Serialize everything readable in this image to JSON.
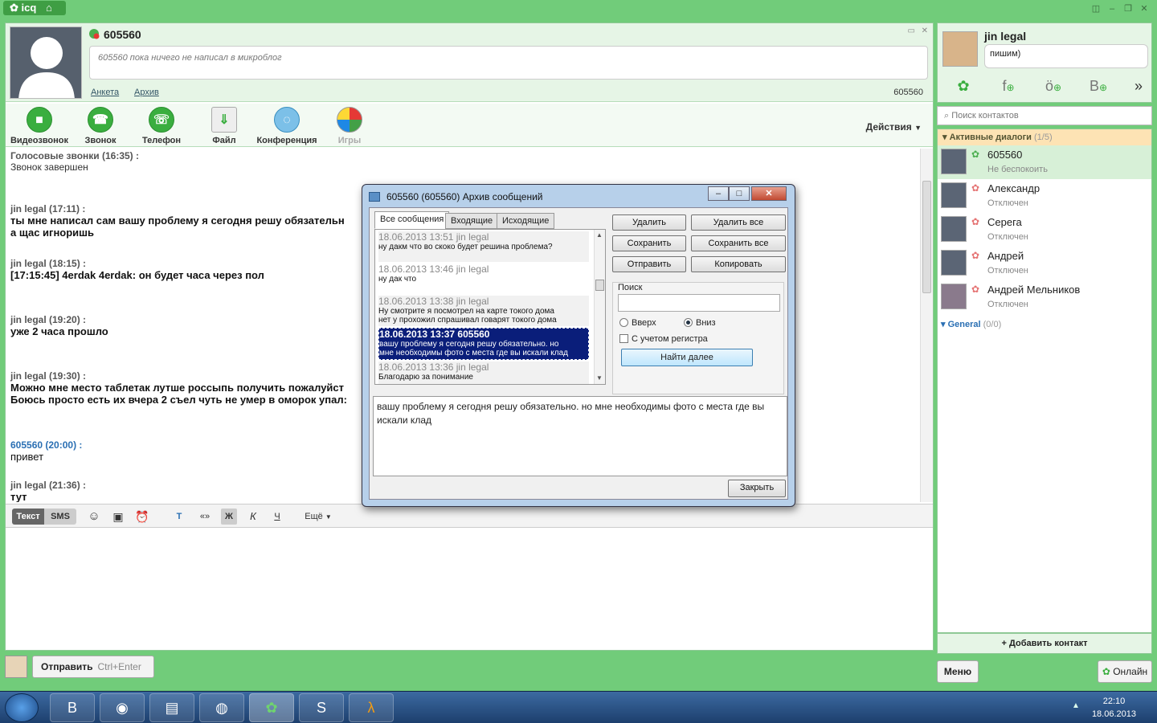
{
  "app": {
    "logo": "icq"
  },
  "header": {
    "contact_name": "605560",
    "microblog": "605560 пока ничего не написал в микроблог",
    "link_profile": "Анкета",
    "link_archive": "Архив",
    "uin": "605560"
  },
  "toolbar": {
    "buttons": [
      {
        "label": "Видеозвонок"
      },
      {
        "label": "Звонок"
      },
      {
        "label": "Телефон"
      },
      {
        "label": "Файл"
      },
      {
        "label": "Конференция"
      },
      {
        "label": "Игры"
      }
    ],
    "actions": "Действия"
  },
  "chat": {
    "messages": [
      {
        "head": "Голосовые звонки (16:35) :",
        "text": "Звонок завершен"
      },
      {
        "head": "jin legal (17:11) :",
        "text": "ты мне написал сам вашу проблему я сегодня решу обязательн",
        "text2": "а щас игноришь"
      },
      {
        "head": "jin legal (18:15) :",
        "text": "[17:15:45] 4erdak 4erdak: он будет часа через пол"
      },
      {
        "head": "jin legal (19:20) :",
        "text": "уже 2 часа прошло"
      },
      {
        "head": "jin legal (19:30) :",
        "text": "Можно мне место таблетак лутше россыпь получить пожалуйст",
        "text2": "Боюсь просто есть их вчера 2 съел чуть не умер в оморок упал:"
      },
      {
        "head": "605560 (20:00) :",
        "text": "привет"
      },
      {
        "head": "jin legal (21:36) :",
        "text": "тут"
      }
    ]
  },
  "format_bar": {
    "tab_text": "Текст",
    "tab_sms": "SMS",
    "more": "Ещё"
  },
  "send": {
    "label": "Отправить",
    "shortcut": "Ctrl+Enter"
  },
  "me": {
    "name": "jin legal",
    "status": "пишим)"
  },
  "search": {
    "placeholder": "Поиск контактов"
  },
  "contacts": {
    "active_header": "Активные диалоги",
    "active_count": "(1/5)",
    "items": [
      {
        "name": "605560",
        "status": "Не беспокоить"
      },
      {
        "name": "Александр",
        "status": "Отключен"
      },
      {
        "name": "Серега",
        "status": "Отключен"
      },
      {
        "name": "Андрей",
        "status": "Отключен"
      },
      {
        "name": "Андрей Мельников",
        "status": "Отключен"
      }
    ],
    "general_header": "General",
    "general_count": "(0/0)",
    "add_contact": "Добавить контакт"
  },
  "bottom": {
    "menu": "Меню",
    "online": "Онлайн"
  },
  "taskbar": {
    "time": "22:10",
    "date": "18.06.2013"
  },
  "dialog": {
    "title": "605560 (605560) Архив сообщений",
    "tabs": [
      "Все сообщения",
      "Входящие",
      "Исходящие"
    ],
    "entries": [
      {
        "head": "18.06.2013 13:51 jin legal",
        "body": "ну дакм что во скоко будет решина проблема?",
        "body2": ""
      },
      {
        "head": "18.06.2013 13:46 jin legal",
        "body": "ну дак что",
        "body2": ""
      },
      {
        "head": "18.06.2013 13:38 jin legal",
        "body": "Ну смотрите я посмотрел на карте токого дома",
        "body2": "нет у прохожил спрашивал говарят токого дома"
      },
      {
        "head": "18.06.2013 13:37 605560",
        "body": "вашу проблему я сегодня решу обязательно. но",
        "body2": "мне необходимы фото с места где вы искали клад"
      },
      {
        "head": "18.06.2013 13:36 jin legal",
        "body": "Благодарю за понимание",
        "body2": ""
      }
    ],
    "buttons": {
      "delete": "Удалить",
      "delete_all": "Удалить все",
      "save": "Сохранить",
      "save_all": "Сохранить все",
      "send": "Отправить",
      "copy": "Копировать"
    },
    "search_label": "Поиск",
    "radio_up": "Вверх",
    "radio_down": "Вниз",
    "case_sensitive": "С учетом регистра",
    "find_next": "Найти далее",
    "selected_text": "вашу проблему я сегодня решу обязательно. но мне необходимы фото с места где вы искали клад",
    "close": "Закрыть"
  }
}
